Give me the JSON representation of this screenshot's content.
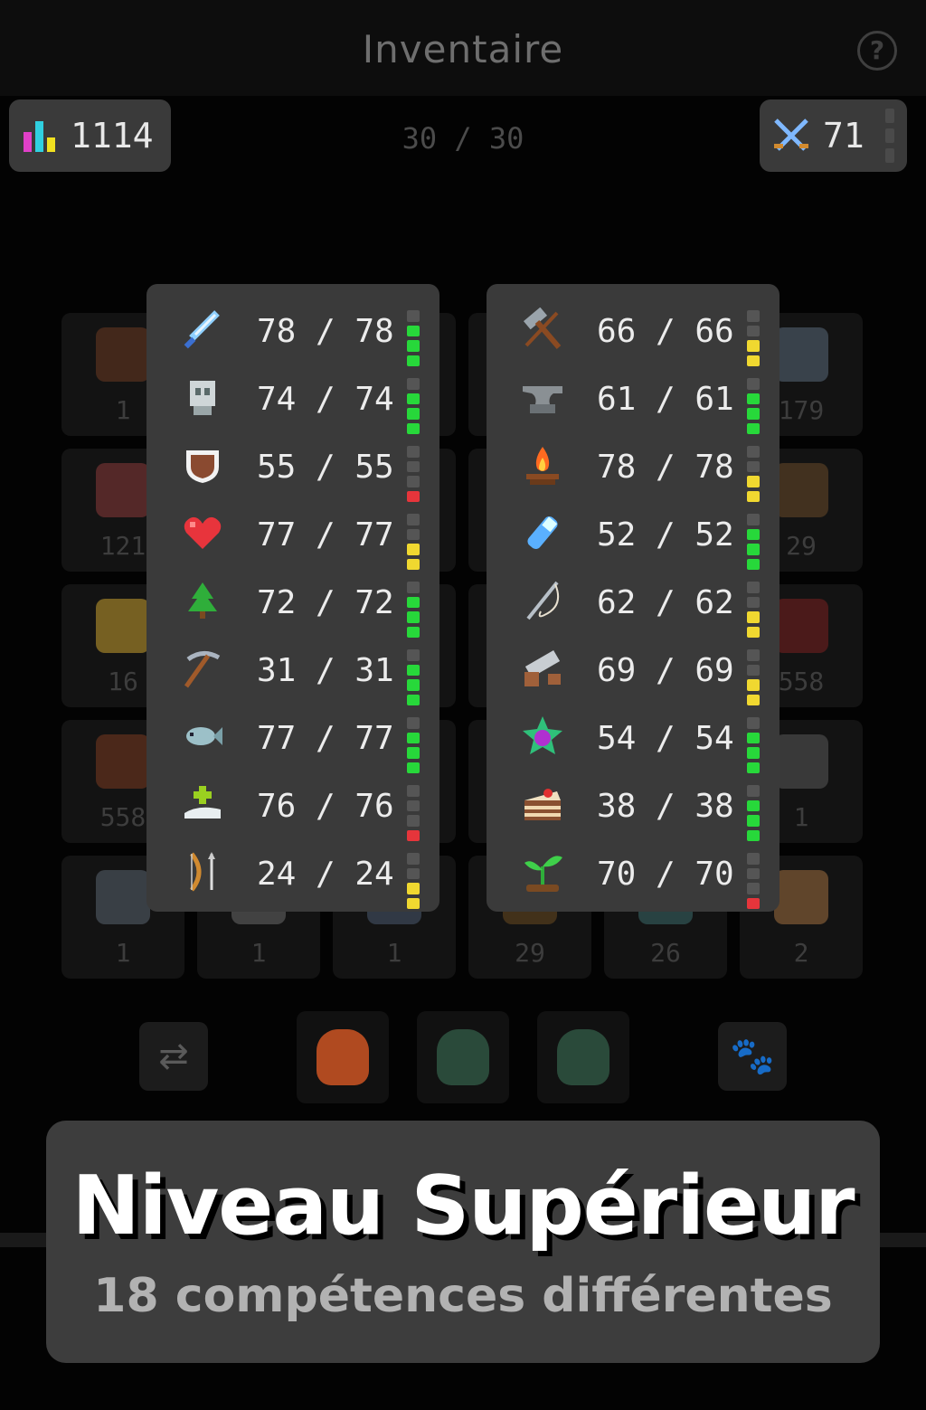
{
  "header": {
    "title": "Inventaire",
    "help_icon": "?"
  },
  "stats": {
    "total_level": "1114",
    "capacity": "30 / 30",
    "combat_level": "71"
  },
  "inventory": {
    "counts": [
      "1",
      "",
      "",
      "",
      "",
      "179",
      "121",
      "",
      "",
      "",
      "",
      "29",
      "16",
      "",
      "",
      "",
      "",
      "558",
      "558",
      "",
      "",
      "",
      "",
      "1",
      "1",
      "1",
      "1",
      "29",
      "26",
      "2"
    ],
    "art_colors": [
      "#6b3a22",
      "",
      "",
      "",
      "",
      "#5a6a7a",
      "#8a3a3a",
      "",
      "",
      "",
      "",
      "#6a4a2a",
      "#c8a030",
      "",
      "",
      "",
      "",
      "#7a2020",
      "#7a3a20",
      "",
      "",
      "",
      "",
      "#5a5a5a",
      "#5a6570",
      "#6a6a6a",
      "#4a5a70",
      "#6a4a20",
      "#3a6a6a",
      "#a07040"
    ]
  },
  "bottom_bar": {
    "swap_icon": "⇄",
    "pet_icon": "🐾",
    "bag_colors": [
      "#b04a20",
      "#2a4a3a",
      "#2a4a3a"
    ]
  },
  "skills_left": [
    {
      "name": "sword-icon",
      "level": "78 / 78",
      "bar": [
        0,
        1,
        1,
        1
      ],
      "color": "#27d83a"
    },
    {
      "name": "defence-icon",
      "level": "74 / 74",
      "bar": [
        0,
        1,
        1,
        1
      ],
      "color": "#27d83a"
    },
    {
      "name": "shield-icon",
      "level": "55 / 55",
      "bar": [
        0,
        0,
        0,
        1
      ],
      "color": "#e6353b"
    },
    {
      "name": "heart-icon",
      "level": "77 / 77",
      "bar": [
        0,
        0,
        1,
        1
      ],
      "color": "#f0d830"
    },
    {
      "name": "tree-icon",
      "level": "72 / 72",
      "bar": [
        0,
        1,
        1,
        1
      ],
      "color": "#27d83a"
    },
    {
      "name": "pickaxe-icon",
      "level": "31 / 31",
      "bar": [
        0,
        1,
        1,
        1
      ],
      "color": "#27d83a"
    },
    {
      "name": "fish-icon",
      "level": "77 / 77",
      "bar": [
        0,
        1,
        1,
        1
      ],
      "color": "#27d83a"
    },
    {
      "name": "healing-icon",
      "level": "76 / 76",
      "bar": [
        0,
        0,
        0,
        1
      ],
      "color": "#e6353b"
    },
    {
      "name": "bow-icon",
      "level": "24 / 24",
      "bar": [
        0,
        0,
        1,
        1
      ],
      "color": "#f0d830"
    }
  ],
  "skills_right": [
    {
      "name": "hammer-icon",
      "level": "66 / 66",
      "bar": [
        0,
        0,
        1,
        1
      ],
      "color": "#f0d830"
    },
    {
      "name": "anvil-icon",
      "level": "61 / 61",
      "bar": [
        0,
        1,
        1,
        1
      ],
      "color": "#27d83a"
    },
    {
      "name": "campfire-icon",
      "level": "78 / 78",
      "bar": [
        0,
        0,
        1,
        1
      ],
      "color": "#f0d830"
    },
    {
      "name": "potion-icon",
      "level": "52 / 52",
      "bar": [
        0,
        1,
        1,
        1
      ],
      "color": "#27d83a"
    },
    {
      "name": "needle-icon",
      "level": "62 / 62",
      "bar": [
        0,
        0,
        1,
        1
      ],
      "color": "#f0d830"
    },
    {
      "name": "saw-icon",
      "level": "69 / 69",
      "bar": [
        0,
        0,
        1,
        1
      ],
      "color": "#f0d830"
    },
    {
      "name": "gem-flower-icon",
      "level": "54 / 54",
      "bar": [
        0,
        1,
        1,
        1
      ],
      "color": "#27d83a"
    },
    {
      "name": "cake-icon",
      "level": "38 / 38",
      "bar": [
        0,
        1,
        1,
        1
      ],
      "color": "#27d83a"
    },
    {
      "name": "sprout-icon",
      "level": "70 / 70",
      "bar": [
        0,
        0,
        0,
        1
      ],
      "color": "#e6353b"
    }
  ],
  "banner": {
    "title": "Niveau Supérieur",
    "subtitle": "18 compétences différentes"
  }
}
